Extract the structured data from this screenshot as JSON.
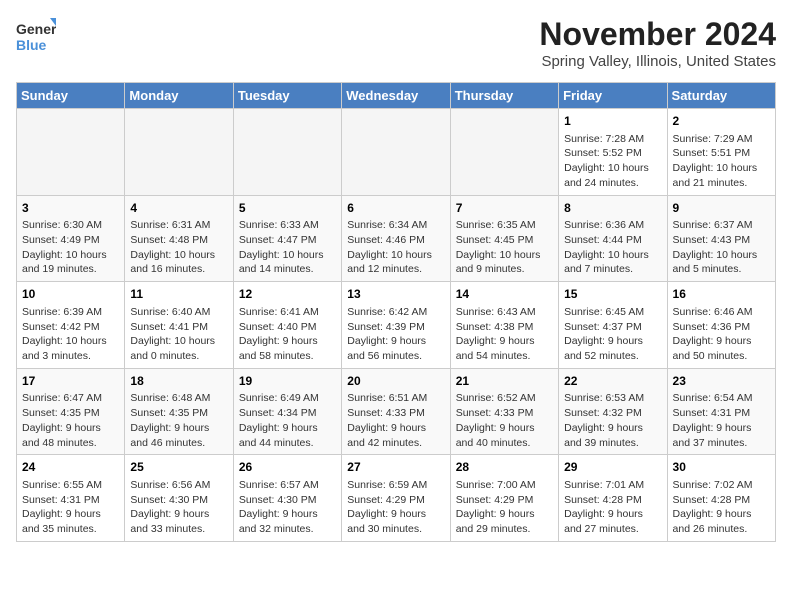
{
  "header": {
    "logo_line1": "General",
    "logo_line2": "Blue",
    "month": "November 2024",
    "location": "Spring Valley, Illinois, United States"
  },
  "weekdays": [
    "Sunday",
    "Monday",
    "Tuesday",
    "Wednesday",
    "Thursday",
    "Friday",
    "Saturday"
  ],
  "weeks": [
    [
      {
        "day": "",
        "info": ""
      },
      {
        "day": "",
        "info": ""
      },
      {
        "day": "",
        "info": ""
      },
      {
        "day": "",
        "info": ""
      },
      {
        "day": "",
        "info": ""
      },
      {
        "day": "1",
        "info": "Sunrise: 7:28 AM\nSunset: 5:52 PM\nDaylight: 10 hours\nand 24 minutes."
      },
      {
        "day": "2",
        "info": "Sunrise: 7:29 AM\nSunset: 5:51 PM\nDaylight: 10 hours\nand 21 minutes."
      }
    ],
    [
      {
        "day": "3",
        "info": "Sunrise: 6:30 AM\nSunset: 4:49 PM\nDaylight: 10 hours\nand 19 minutes."
      },
      {
        "day": "4",
        "info": "Sunrise: 6:31 AM\nSunset: 4:48 PM\nDaylight: 10 hours\nand 16 minutes."
      },
      {
        "day": "5",
        "info": "Sunrise: 6:33 AM\nSunset: 4:47 PM\nDaylight: 10 hours\nand 14 minutes."
      },
      {
        "day": "6",
        "info": "Sunrise: 6:34 AM\nSunset: 4:46 PM\nDaylight: 10 hours\nand 12 minutes."
      },
      {
        "day": "7",
        "info": "Sunrise: 6:35 AM\nSunset: 4:45 PM\nDaylight: 10 hours\nand 9 minutes."
      },
      {
        "day": "8",
        "info": "Sunrise: 6:36 AM\nSunset: 4:44 PM\nDaylight: 10 hours\nand 7 minutes."
      },
      {
        "day": "9",
        "info": "Sunrise: 6:37 AM\nSunset: 4:43 PM\nDaylight: 10 hours\nand 5 minutes."
      }
    ],
    [
      {
        "day": "10",
        "info": "Sunrise: 6:39 AM\nSunset: 4:42 PM\nDaylight: 10 hours\nand 3 minutes."
      },
      {
        "day": "11",
        "info": "Sunrise: 6:40 AM\nSunset: 4:41 PM\nDaylight: 10 hours\nand 0 minutes."
      },
      {
        "day": "12",
        "info": "Sunrise: 6:41 AM\nSunset: 4:40 PM\nDaylight: 9 hours\nand 58 minutes."
      },
      {
        "day": "13",
        "info": "Sunrise: 6:42 AM\nSunset: 4:39 PM\nDaylight: 9 hours\nand 56 minutes."
      },
      {
        "day": "14",
        "info": "Sunrise: 6:43 AM\nSunset: 4:38 PM\nDaylight: 9 hours\nand 54 minutes."
      },
      {
        "day": "15",
        "info": "Sunrise: 6:45 AM\nSunset: 4:37 PM\nDaylight: 9 hours\nand 52 minutes."
      },
      {
        "day": "16",
        "info": "Sunrise: 6:46 AM\nSunset: 4:36 PM\nDaylight: 9 hours\nand 50 minutes."
      }
    ],
    [
      {
        "day": "17",
        "info": "Sunrise: 6:47 AM\nSunset: 4:35 PM\nDaylight: 9 hours\nand 48 minutes."
      },
      {
        "day": "18",
        "info": "Sunrise: 6:48 AM\nSunset: 4:35 PM\nDaylight: 9 hours\nand 46 minutes."
      },
      {
        "day": "19",
        "info": "Sunrise: 6:49 AM\nSunset: 4:34 PM\nDaylight: 9 hours\nand 44 minutes."
      },
      {
        "day": "20",
        "info": "Sunrise: 6:51 AM\nSunset: 4:33 PM\nDaylight: 9 hours\nand 42 minutes."
      },
      {
        "day": "21",
        "info": "Sunrise: 6:52 AM\nSunset: 4:33 PM\nDaylight: 9 hours\nand 40 minutes."
      },
      {
        "day": "22",
        "info": "Sunrise: 6:53 AM\nSunset: 4:32 PM\nDaylight: 9 hours\nand 39 minutes."
      },
      {
        "day": "23",
        "info": "Sunrise: 6:54 AM\nSunset: 4:31 PM\nDaylight: 9 hours\nand 37 minutes."
      }
    ],
    [
      {
        "day": "24",
        "info": "Sunrise: 6:55 AM\nSunset: 4:31 PM\nDaylight: 9 hours\nand 35 minutes."
      },
      {
        "day": "25",
        "info": "Sunrise: 6:56 AM\nSunset: 4:30 PM\nDaylight: 9 hours\nand 33 minutes."
      },
      {
        "day": "26",
        "info": "Sunrise: 6:57 AM\nSunset: 4:30 PM\nDaylight: 9 hours\nand 32 minutes."
      },
      {
        "day": "27",
        "info": "Sunrise: 6:59 AM\nSunset: 4:29 PM\nDaylight: 9 hours\nand 30 minutes."
      },
      {
        "day": "28",
        "info": "Sunrise: 7:00 AM\nSunset: 4:29 PM\nDaylight: 9 hours\nand 29 minutes."
      },
      {
        "day": "29",
        "info": "Sunrise: 7:01 AM\nSunset: 4:28 PM\nDaylight: 9 hours\nand 27 minutes."
      },
      {
        "day": "30",
        "info": "Sunrise: 7:02 AM\nSunset: 4:28 PM\nDaylight: 9 hours\nand 26 minutes."
      }
    ]
  ]
}
